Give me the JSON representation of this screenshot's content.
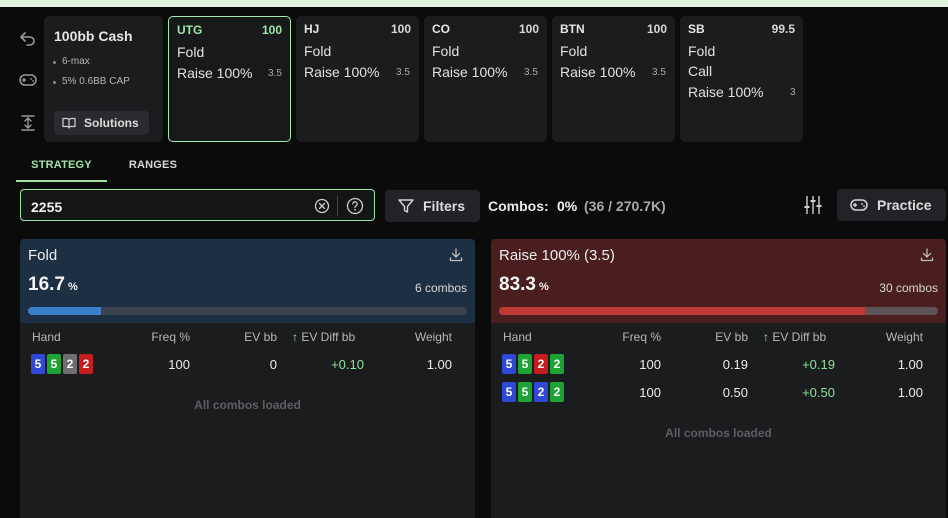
{
  "setup": {
    "title": "100bb Cash",
    "details": [
      "6-max",
      "5% 0.6BB CAP"
    ],
    "solutions_label": "Solutions"
  },
  "positions": [
    {
      "name": "UTG",
      "stack": "100",
      "actions": [
        {
          "label": "Fold",
          "size": ""
        },
        {
          "label": "Raise 100%",
          "size": "3.5"
        }
      ],
      "active": true
    },
    {
      "name": "HJ",
      "stack": "100",
      "actions": [
        {
          "label": "Fold",
          "size": ""
        },
        {
          "label": "Raise 100%",
          "size": "3.5"
        }
      ],
      "active": false
    },
    {
      "name": "CO",
      "stack": "100",
      "actions": [
        {
          "label": "Fold",
          "size": ""
        },
        {
          "label": "Raise 100%",
          "size": "3.5"
        }
      ],
      "active": false
    },
    {
      "name": "BTN",
      "stack": "100",
      "actions": [
        {
          "label": "Fold",
          "size": ""
        },
        {
          "label": "Raise 100%",
          "size": "3.5"
        }
      ],
      "active": false
    },
    {
      "name": "SB",
      "stack": "99.5",
      "actions": [
        {
          "label": "Fold",
          "size": ""
        },
        {
          "label": "Call",
          "size": ""
        },
        {
          "label": "Raise 100%",
          "size": "3"
        }
      ],
      "active": false
    }
  ],
  "tabs": {
    "strategy": "STRATEGY",
    "ranges": "RANGES",
    "active": "strategy"
  },
  "search": {
    "value": "2255"
  },
  "filters_label": "Filters",
  "combos": {
    "label": "Combos:",
    "percent": "0%",
    "count": "(36 / 270.7K)"
  },
  "practice_label": "Practice",
  "columns": {
    "hand": "Hand",
    "freq": "Freq %",
    "ev": "EV bb",
    "ev_diff": "EV Diff bb",
    "weight": "Weight"
  },
  "panels": {
    "fold": {
      "title": "Fold",
      "percent": "16.7",
      "percent_unit": "%",
      "combos": "6 combos",
      "bar_fraction": 0.167,
      "rows": [
        {
          "cards": [
            {
              "rank": "5",
              "suit_color": "blue"
            },
            {
              "rank": "5",
              "suit_color": "green"
            },
            {
              "rank": "2",
              "suit_color": "gray"
            },
            {
              "rank": "2",
              "suit_color": "red"
            }
          ],
          "freq": "100",
          "ev": "0",
          "ev_diff": "+0.10",
          "weight": "1.00"
        }
      ],
      "footer": "All combos loaded"
    },
    "raise": {
      "title": "Raise 100% (3.5)",
      "percent": "83.3",
      "percent_unit": "%",
      "combos": "30 combos",
      "bar_fraction": 0.833,
      "rows": [
        {
          "cards": [
            {
              "rank": "5",
              "suit_color": "blue"
            },
            {
              "rank": "5",
              "suit_color": "green"
            },
            {
              "rank": "2",
              "suit_color": "red"
            },
            {
              "rank": "2",
              "suit_color": "green"
            }
          ],
          "freq": "100",
          "ev": "0.19",
          "ev_diff": "+0.19",
          "weight": "1.00"
        },
        {
          "cards": [
            {
              "rank": "5",
              "suit_color": "blue"
            },
            {
              "rank": "5",
              "suit_color": "green"
            },
            {
              "rank": "2",
              "suit_color": "blue"
            },
            {
              "rank": "2",
              "suit_color": "green"
            }
          ],
          "freq": "100",
          "ev": "0.50",
          "ev_diff": "+0.50",
          "weight": "1.00"
        }
      ],
      "footer": "All combos loaded"
    }
  },
  "icons": {
    "toolbar": [
      "undo-icon",
      "gamepad-icon",
      "vertical-expand-icon"
    ],
    "solutions": "book-icon",
    "search_clear": "clear-circle-icon",
    "search_help": "help-circle-icon",
    "filters": "funnel-icon",
    "adjust": "sliders-icon",
    "practice": "gamepad-icon",
    "download": "download-icon",
    "sort": "up-arrow-icon"
  },
  "colors": {
    "accent": "#9fe3a8",
    "fold": "#3a7fc8",
    "raise": "#c03a35"
  }
}
